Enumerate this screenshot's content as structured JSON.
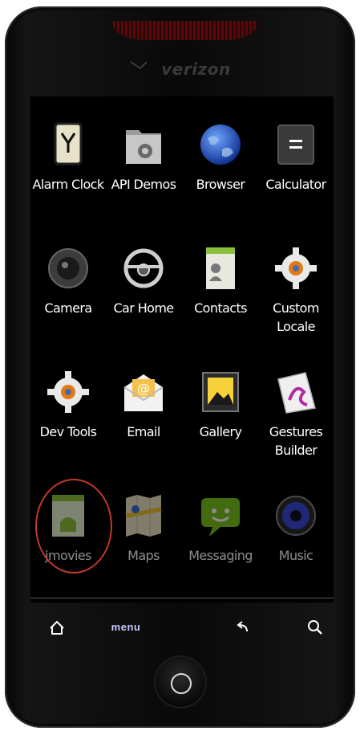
{
  "device": {
    "carrier": "verizon"
  },
  "apps": [
    {
      "label": "Alarm Clock",
      "icon": "alarm-clock-icon"
    },
    {
      "label": "API Demos",
      "icon": "folder-gear-icon"
    },
    {
      "label": "Browser",
      "icon": "globe-icon"
    },
    {
      "label": "Calculator",
      "icon": "calculator-icon"
    },
    {
      "label": "Camera",
      "icon": "camera-icon"
    },
    {
      "label": "Car Home",
      "icon": "steering-wheel-icon"
    },
    {
      "label": "Contacts",
      "icon": "contacts-icon"
    },
    {
      "label": "Custom\nLocale",
      "icon": "gear-icon"
    },
    {
      "label": "Dev Tools",
      "icon": "gear-icon"
    },
    {
      "label": "Email",
      "icon": "envelope-icon"
    },
    {
      "label": "Gallery",
      "icon": "picture-icon"
    },
    {
      "label": "Gestures\nBuilder",
      "icon": "gestures-icon"
    },
    {
      "label": "jmovies",
      "icon": "android-app-icon"
    },
    {
      "label": "Maps",
      "icon": "map-icon"
    },
    {
      "label": "Messaging",
      "icon": "chat-bubble-icon"
    },
    {
      "label": "Music",
      "icon": "speaker-icon"
    }
  ],
  "navbar": {
    "menu_label": "menu"
  },
  "colors": {
    "highlight_circle": "#c0392b",
    "nav_icon": "#c9c9ff"
  }
}
